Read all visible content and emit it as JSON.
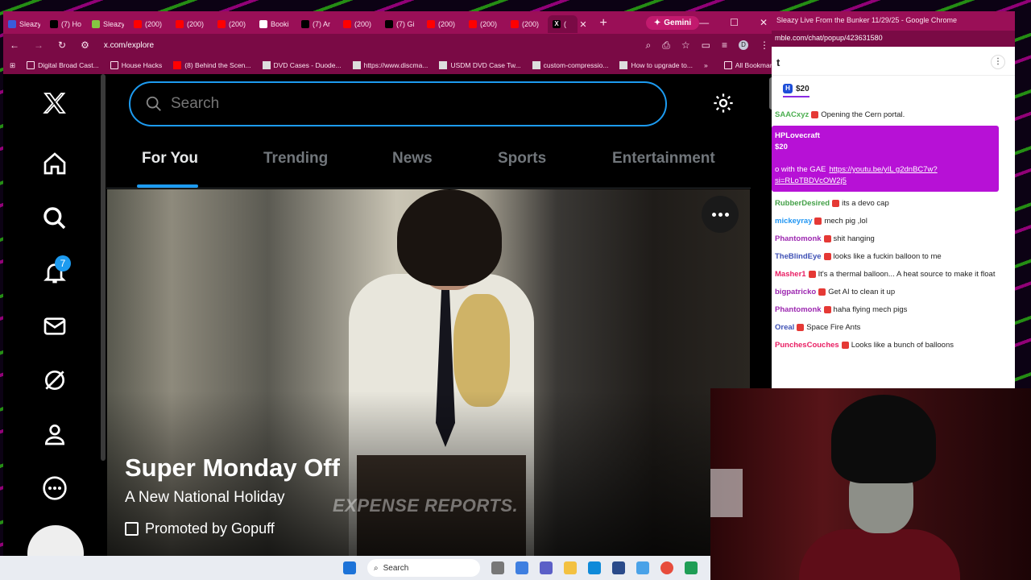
{
  "browser": {
    "tabs": [
      {
        "label": "Sleazy",
        "favicon": "rumble-icon",
        "color": "#3b5bdb"
      },
      {
        "label": "(7) Ho",
        "favicon": "x-icon",
        "color": "#000000"
      },
      {
        "label": "Sleazy",
        "favicon": "rumble-icon",
        "color": "#85c742"
      },
      {
        "label": "(200)",
        "favicon": "youtube-icon",
        "color": "#ff0000"
      },
      {
        "label": "(200)",
        "favicon": "youtube-icon",
        "color": "#ff0000"
      },
      {
        "label": "(200)",
        "favicon": "youtube-icon",
        "color": "#ff0000"
      },
      {
        "label": "Booki",
        "favicon": "star-icon",
        "color": "#ffffff"
      },
      {
        "label": "(7) Ar",
        "favicon": "x-icon",
        "color": "#000000"
      },
      {
        "label": "(200)",
        "favicon": "youtube-icon",
        "color": "#ff0000"
      },
      {
        "label": "(7) Gi",
        "favicon": "x-icon",
        "color": "#000000"
      },
      {
        "label": "(200)",
        "favicon": "youtube-icon",
        "color": "#ff0000"
      },
      {
        "label": "(200)",
        "favicon": "youtube-icon",
        "color": "#ff0000"
      },
      {
        "label": "(200)",
        "favicon": "youtube-icon",
        "color": "#ff0000"
      }
    ],
    "active_tab_label": "(",
    "gemini_label": "Gemini",
    "url": "x.com/explore",
    "profile_initial": "D",
    "bookmarks": [
      {
        "label": "Digital Broad Cast...",
        "icon": "folder-icon"
      },
      {
        "label": "House Hacks",
        "icon": "folder-icon"
      },
      {
        "label": "(8) Behind the Scen...",
        "icon": "youtube-icon"
      },
      {
        "label": "DVD Cases - Duode...",
        "icon": "page-icon"
      },
      {
        "label": "https://www.discma...",
        "icon": "page-icon"
      },
      {
        "label": "USDM DVD Case Tw...",
        "icon": "page-icon"
      },
      {
        "label": "custom-compressio...",
        "icon": "page-icon"
      },
      {
        "label": "How to upgrade to...",
        "icon": "page-icon"
      }
    ],
    "all_bookmarks_label": "All Bookmarks",
    "theme_color": "#9a0f57"
  },
  "xpage": {
    "search_placeholder": "Search",
    "notification_count": "7",
    "tabs": [
      "For You",
      "Trending",
      "News",
      "Sports",
      "Entertainment"
    ],
    "active_tab": "For You",
    "hero": {
      "title": "Super Monday Off",
      "subtitle": "A New National Holiday",
      "promoted": "Promoted by Gopuff",
      "watermark": "EXPENSE REPORTS."
    },
    "accent_color": "#1d9bf0"
  },
  "chat": {
    "window_title": "Sleazy Live From the Bunker 11/29/25 - Google Chrome",
    "url": "mble.com/chat/popup/423631580",
    "header": "t",
    "rant_pill": "$20",
    "messages": [
      {
        "user": "SAACxyz",
        "text": "Opening the Cern portal.",
        "color": "#4caf50"
      },
      {
        "type": "rant",
        "user": "HPLovecraft",
        "amount": "$20",
        "text": "o with the GAE",
        "link": "https://youtu.be/yIL g2dnBC7w?si=RLoTBDVcOW2j5"
      },
      {
        "user": "RubberDesired",
        "text": "its a devo cap",
        "color": "#43a047"
      },
      {
        "user": "mickeyray",
        "text": "mech pig ,lol",
        "color": "#2196f3"
      },
      {
        "user": "Phantomonk",
        "text": "shit hanging",
        "color": "#9c27b0"
      },
      {
        "user": "TheBlindEye",
        "text": "looks like a fuckin balloon to me",
        "color": "#3f51b5"
      },
      {
        "user": "Masher1",
        "text": "It's a thermal balloon... A heat source to make it float",
        "color": "#e91e63"
      },
      {
        "user": "bigpatricko",
        "text": "Get AI to clean it up",
        "color": "#9c27b0"
      },
      {
        "user": "Phantomonk",
        "text": "haha flying mech pigs",
        "color": "#9c27b0"
      },
      {
        "user": "Oreal",
        "text": "Space Fire Ants",
        "color": "#3f51b5"
      },
      {
        "user": "PunchesCouches",
        "text": "Looks like a bunch of balloons",
        "color": "#e91e63"
      }
    ]
  },
  "taskbar": {
    "search_label": "Search"
  }
}
